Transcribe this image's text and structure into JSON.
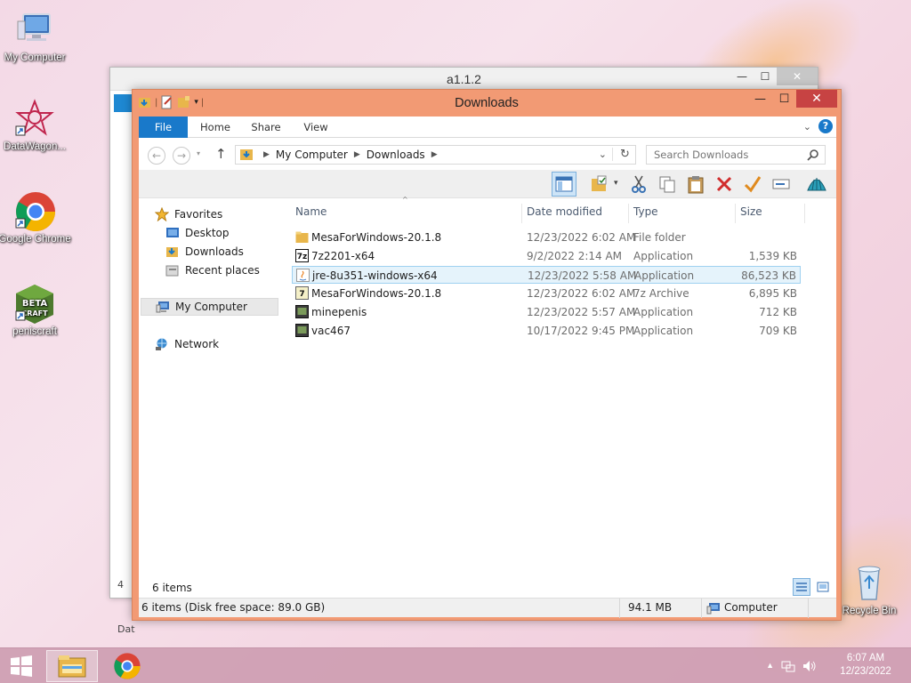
{
  "desktop": {
    "icons": [
      {
        "label": "My Computer"
      },
      {
        "label": "DataWagon..."
      },
      {
        "label": "Google Chrome"
      },
      {
        "label": "peniscraft"
      },
      {
        "label": "Recycle Bin"
      }
    ]
  },
  "back_window": {
    "title": "a1.1.2",
    "peek_text_1": "4",
    "peek_text_2": "Dat"
  },
  "window": {
    "title": "Downloads",
    "controls": {
      "minimize": "—",
      "maximize": "☐",
      "close": "✕"
    }
  },
  "ribbon": {
    "tabs": [
      "File",
      "Home",
      "Share",
      "View"
    ],
    "help": "?"
  },
  "address": {
    "crumbs": [
      "My Computer",
      "Downloads"
    ],
    "search_placeholder": "Search Downloads"
  },
  "nav_pane": {
    "favorites": "Favorites",
    "desktop": "Desktop",
    "downloads": "Downloads",
    "recent": "Recent places",
    "my_computer": "My Computer",
    "network": "Network"
  },
  "columns": {
    "name": "Name",
    "date": "Date modified",
    "type": "Type",
    "size": "Size"
  },
  "files": [
    {
      "name": "MesaForWindows-20.1.8",
      "date": "12/23/2022 6:02 AM",
      "type": "File folder",
      "size": "",
      "icon": "folder-icon"
    },
    {
      "name": "7z2201-x64",
      "date": "9/2/2022 2:14 AM",
      "type": "Application",
      "size": "1,539 KB",
      "icon": "7zip-icon"
    },
    {
      "name": "jre-8u351-windows-x64",
      "date": "12/23/2022 5:58 AM",
      "type": "Application",
      "size": "86,523 KB",
      "icon": "java-icon"
    },
    {
      "name": "MesaForWindows-20.1.8",
      "date": "12/23/2022 6:02 AM",
      "type": "7z Archive",
      "size": "6,895 KB",
      "icon": "archive-icon"
    },
    {
      "name": "minepenis",
      "date": "12/23/2022 5:57 AM",
      "type": "Application",
      "size": "712 KB",
      "icon": "app-icon"
    },
    {
      "name": "vac467",
      "date": "10/17/2022 9:45 PM",
      "type": "Application",
      "size": "709 KB",
      "icon": "app-icon"
    }
  ],
  "status": {
    "items": "6 items",
    "bottom_left": "6 items (Disk free space: 89.0 GB)",
    "size": "94.1 MB",
    "location": "Computer"
  },
  "taskbar": {
    "time": "6:07 AM",
    "date": "12/23/2022"
  },
  "colors": {
    "accent": "#1979ca",
    "frame": "#f29a74",
    "close": "#c74343",
    "selection": "#e5f3fb"
  }
}
